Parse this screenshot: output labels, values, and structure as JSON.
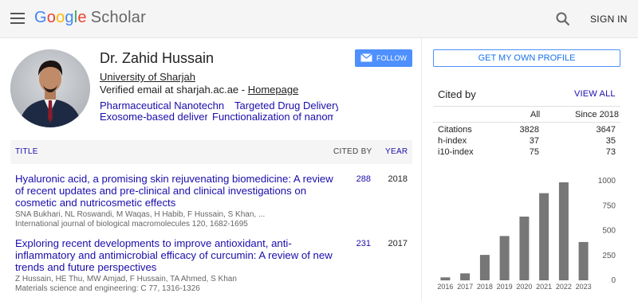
{
  "header": {
    "logo_letters": [
      "G",
      "o",
      "o",
      "g",
      "l",
      "e"
    ],
    "logo_suffix": "Scholar",
    "signin_label": "SIGN IN"
  },
  "profile": {
    "name": "Dr. Zahid Hussain",
    "affiliation": "University of Sharjah",
    "email_text": "Verified email at sharjah.ac.ae - ",
    "homepage_label": "Homepage",
    "follow_label": "FOLLOW",
    "interests": [
      "Pharmaceutical Nanotechn…",
      "Targeted Drug Delivery",
      "Exosome-based delivery",
      "Functionalization of nanom…"
    ]
  },
  "get_profile_label": "GET MY OWN PROFILE",
  "table": {
    "col_title": "TITLE",
    "col_cited": "CITED BY",
    "col_year": "YEAR",
    "rows": [
      {
        "title": "Hyaluronic acid, a promising skin rejuvenating biomedicine: A review of recent updates and pre-clinical and clinical investigations on cosmetic and nutricosmetic effects",
        "authors": "SNA Bukhari, NL Roswandi, M Waqas, H Habib, F Hussain, S Khan, ...",
        "venue": "International journal of biological macromolecules 120, 1682-1695",
        "cited": "288",
        "year": "2018"
      },
      {
        "title": "Exploring recent developments to improve antioxidant, anti-inflammatory and antimicrobial efficacy of curcumin: A review of new trends and future perspectives",
        "authors": "Z Hussain, HE Thu, MW Amjad, F Hussain, TA Ahmed, S Khan",
        "venue": "Materials science and engineering: C 77, 1316-1326",
        "cited": "231",
        "year": "2017"
      }
    ]
  },
  "cited_by": {
    "title": "Cited by",
    "view_all": "VIEW ALL",
    "col_all": "All",
    "col_since": "Since 2018",
    "rows": [
      {
        "label": "Citations",
        "all": "3828",
        "since": "3647"
      },
      {
        "label": "h-index",
        "all": "37",
        "since": "35"
      },
      {
        "label": "i10-index",
        "all": "75",
        "since": "73"
      }
    ]
  },
  "colors": {
    "link": "#1a0dab",
    "accent": "#4d90fe",
    "bar": "#777777"
  },
  "chart_data": {
    "type": "bar",
    "categories": [
      "2016",
      "2017",
      "2018",
      "2019",
      "2020",
      "2021",
      "2022",
      "2023"
    ],
    "values": [
      30,
      70,
      255,
      445,
      640,
      875,
      985,
      385
    ],
    "ylim": [
      0,
      1000
    ],
    "yticks": [
      "0",
      "250",
      "500",
      "750",
      "1000"
    ],
    "y_axis_side": "right",
    "grid": false
  }
}
